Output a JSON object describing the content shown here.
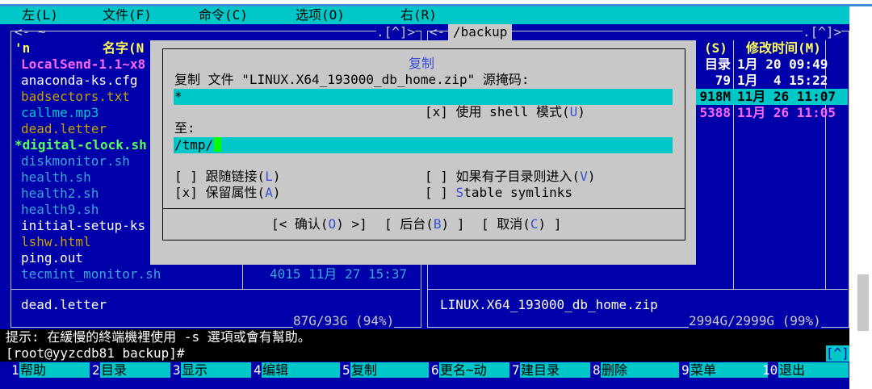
{
  "menu": [
    "左(L)",
    "文件(F)",
    "命令(C)",
    "选项(O)",
    "右(R)"
  ],
  "left_panel": {
    "header_dir": "~",
    "header_btns": ".[^]>",
    "col_n": "'n",
    "col_name": "名字(N",
    "files": [
      {
        "name": "LocalSend-1.1~x8",
        "color": "#ff66ff",
        "bold": true
      },
      {
        "name": "anaconda-ks.cfg",
        "color": "#ffffff",
        "bold": false
      },
      {
        "name": "badsectors.txt",
        "color": "#c8a000",
        "bold": false
      },
      {
        "name": "callme.mp3",
        "color": "#00c8c8",
        "bold": false
      },
      {
        "name": "dead.letter",
        "color": "#c8a000",
        "bold": false
      },
      {
        "name": "*digital-clock.sh",
        "color": "#55ff55",
        "bold": true
      },
      {
        "name": "diskmonitor.sh",
        "color": "#3aa8d6",
        "bold": false
      },
      {
        "name": "health.sh",
        "color": "#3aa8d6",
        "bold": false
      },
      {
        "name": "health2.sh",
        "color": "#3aa8d6",
        "bold": false
      },
      {
        "name": "health9.sh",
        "color": "#3aa8d6",
        "bold": false
      },
      {
        "name": "initial-setup-ks",
        "color": "#ffffff",
        "bold": false
      },
      {
        "name": "lshw.html",
        "color": "#c8a000",
        "bold": false
      },
      {
        "name": "ping.out",
        "color": "#ffffff",
        "bold": false
      },
      {
        "name": "tecmint_monitor.sh",
        "color": "#3aa8d6",
        "bold": false
      }
    ],
    "last_row_info": "4015 11月 27 15:37",
    "mini_status": "dead.letter",
    "disk": "87G/93G (94%)"
  },
  "right_panel": {
    "header_dir": "/backup",
    "header_btns": ".[^]>",
    "col_size": "(S)",
    "col_mtime": "修改时间(M)",
    "rows": [
      {
        "size": "目录",
        "date": "1月 20 09:49",
        "color": "#ffffff"
      },
      {
        "size": "79",
        "date": "1月  4 15:22",
        "color": "#ffffff"
      },
      {
        "size": "918M",
        "date": "11月 26 11:07",
        "color": "#000000"
      },
      {
        "size": "5388",
        "date": "11月 26 11:05",
        "color": "#ff66ff"
      }
    ],
    "mini_status": "LINUX.X64_193000_db_home.zip",
    "disk": "2994G/2999G (99%)"
  },
  "dialog": {
    "title": "复制",
    "source_label": "复制 文件 \"LINUX.X64_193000_db_home.zip\" 源掩码:",
    "source_value": "*",
    "shell_checkbox": "[x]",
    "shell_label": "使用 shell 模式(",
    "shell_hot": "U",
    "to_label": "至:",
    "to_value": "/tmp/",
    "opt_follow_box": "[ ]",
    "opt_follow_label": "跟随链接(",
    "opt_follow_hot": "L",
    "opt_preserve_box": "[x]",
    "opt_preserve_label": "保留属性(",
    "opt_preserve_hot": "A",
    "opt_dive_box": "[ ]",
    "opt_dive_label": "如果有子目录则进入(",
    "opt_dive_hot": "V",
    "opt_stable_box": "[ ]",
    "opt_stable_hot": "S",
    "opt_stable_label": "table symlinks",
    "btn_ok_pre": "[< 确认(",
    "btn_ok_hot": "O",
    "btn_ok_post": ") >]",
    "btn_bg_pre": "[ 后台(",
    "btn_bg_hot": "B",
    "btn_bg_post": ") ]",
    "btn_cancel_pre": "[ 取消(",
    "btn_cancel_hot": "C",
    "btn_cancel_post": ") ]"
  },
  "hint": "提示: 在緩慢的終端機裡使用 -s 選項或會有幫助。",
  "prompt": "[root@yyzcdb81 backup]#",
  "prompt_btn": "[^]",
  "fkeys": [
    {
      "num": "1",
      "label": "帮助"
    },
    {
      "num": "2",
      "label": "目录"
    },
    {
      "num": "3",
      "label": "显示"
    },
    {
      "num": "4",
      "label": "编辑"
    },
    {
      "num": "5",
      "label": "复制"
    },
    {
      "num": "6",
      "label": "更名~动"
    },
    {
      "num": "7",
      "label": "建目录"
    },
    {
      "num": "8",
      "label": "删除"
    },
    {
      "num": "9",
      "label": "菜单"
    },
    {
      "num": "10",
      "label": "退出"
    }
  ]
}
